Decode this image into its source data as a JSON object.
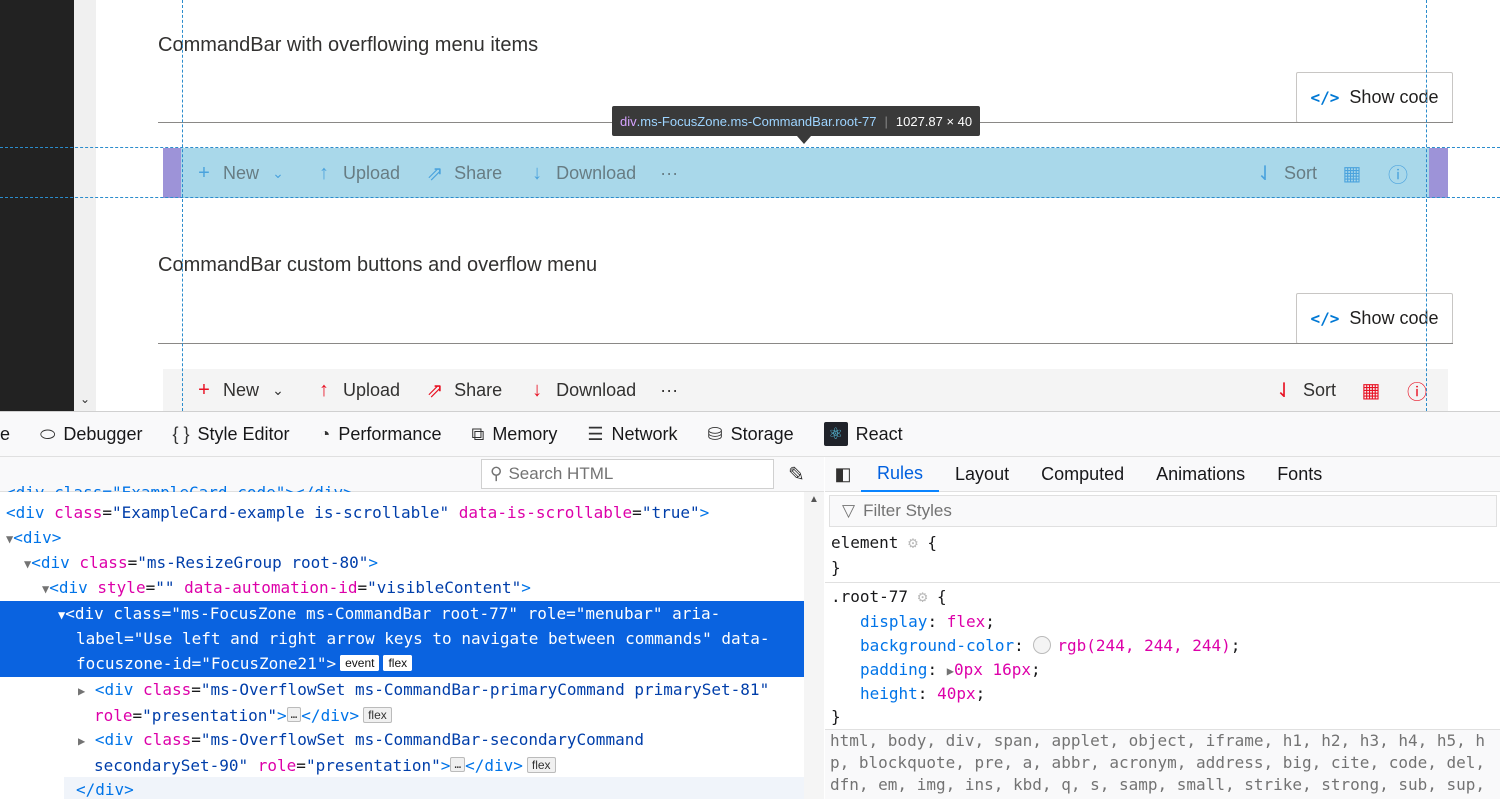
{
  "sections": [
    {
      "title": "CommandBar with overflowing menu items",
      "show_code": "Show code"
    },
    {
      "title": "CommandBar custom buttons and overflow menu",
      "show_code": "Show code"
    }
  ],
  "commandbar": {
    "new": "New",
    "upload": "Upload",
    "share": "Share",
    "download": "Download",
    "more": "···",
    "sort": "Sort"
  },
  "tooltip": {
    "tag": "div",
    "classes": ".ms-FocusZone.ms-CommandBar.root-77",
    "size": "1027.87 × 40"
  },
  "devtools": {
    "tabs": [
      {
        "label": "e",
        "icon": ""
      },
      {
        "label": "Debugger",
        "icon": "debugger-icon"
      },
      {
        "label": "Style Editor",
        "icon": "style-editor-icon"
      },
      {
        "label": "Performance",
        "icon": "performance-icon"
      },
      {
        "label": "Memory",
        "icon": "memory-icon"
      },
      {
        "label": "Network",
        "icon": "network-icon"
      },
      {
        "label": "Storage",
        "icon": "storage-icon"
      },
      {
        "label": "React",
        "icon": "react-icon"
      }
    ],
    "search_placeholder": "Search HTML",
    "rules_tabs": [
      "Rules",
      "Layout",
      "Computed",
      "Animations",
      "Fonts"
    ],
    "filter_placeholder": "Filter Styles"
  },
  "html_tree": {
    "line0": "<div class=\"ExampleCard-code\"></div>",
    "line1_tag": "<div",
    "line1_attr": "class",
    "line1_val": "\"ExampleCard-example is-scrollable\"",
    "line1_attr2": "data-is-scrollable",
    "line1_val2": "\"true\"",
    "line1_end": ">",
    "line2": "<div>",
    "line3_attr": "class",
    "line3_val": "\"ms-ResizeGroup root-80\"",
    "line4_attr": "style",
    "line4_val": "\"\"",
    "line4_attr2": "data-automation-id",
    "line4_val2": "\"visibleContent\"",
    "sel_a": "<div class=\"ms-FocusZone ms-CommandBar root-77\" role=\"menubar\" aria-",
    "sel_b": "label=\"Use left and right arrow keys to navigate between commands\" data-",
    "sel_c": "focuszone-id=\"FocusZone21\">",
    "badge_event": "event",
    "badge_flex": "flex",
    "c1_val": "\"ms-OverflowSet ms-CommandBar-primaryCommand primarySet-81\"",
    "c1_role": "\"presentation\"",
    "c2_val": "\"ms-OverflowSet ms-CommandBar-secondaryCommand",
    "c2_val2": "secondarySet-90\"",
    "c2_role": "\"presentation\"",
    "close": "</div>"
  },
  "rules": {
    "r1_selector": "element",
    "r2_selector": ".root-77",
    "decls": [
      {
        "prop": "display",
        "val": "flex"
      },
      {
        "prop": "background-color",
        "val": "rgb(244, 244, 244)"
      },
      {
        "prop": "padding",
        "val": "0px 16px"
      },
      {
        "prop": "height",
        "val": "40px"
      }
    ],
    "inherited_1": "html, body, div, span, applet, object, iframe, h1, h2, h3, h4, h5, h",
    "inherited_2": "p, blockquote, pre, a, abbr, acronym, address, big, cite, code, del,",
    "inherited_3": "dfn, em, img, ins, kbd, q, s, samp, small, strike, strong, sub, sup,"
  },
  "colors": {
    "accent": "#0078d4",
    "danger": "#e81123",
    "selection": "#0a63e0"
  }
}
